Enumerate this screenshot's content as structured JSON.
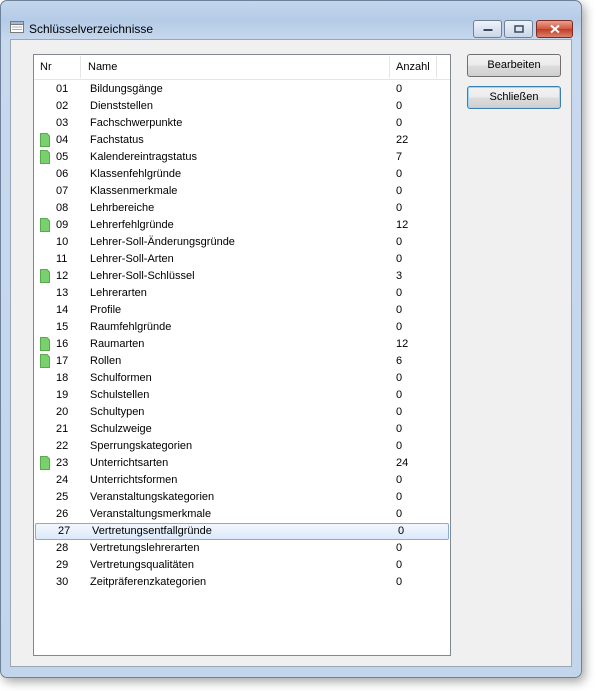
{
  "window": {
    "title": "Schlüsselverzeichnisse"
  },
  "columns": {
    "nr": "Nr",
    "name": "Name",
    "count": "Anzahl"
  },
  "buttons": {
    "edit": "Bearbeiten",
    "close": "Schließen"
  },
  "colors": {
    "doc_icon": "#79d16e",
    "selection": "#84acdd"
  },
  "rows": [
    {
      "nr": "01",
      "name": "Bildungsgänge",
      "count": "0",
      "icon": false
    },
    {
      "nr": "02",
      "name": "Dienststellen",
      "count": "0",
      "icon": false
    },
    {
      "nr": "03",
      "name": "Fachschwerpunkte",
      "count": "0",
      "icon": false
    },
    {
      "nr": "04",
      "name": "Fachstatus",
      "count": "22",
      "icon": true
    },
    {
      "nr": "05",
      "name": "Kalendereintragstatus",
      "count": "7",
      "icon": true
    },
    {
      "nr": "06",
      "name": "Klassenfehlgründe",
      "count": "0",
      "icon": false
    },
    {
      "nr": "07",
      "name": "Klassenmerkmale",
      "count": "0",
      "icon": false
    },
    {
      "nr": "08",
      "name": "Lehrbereiche",
      "count": "0",
      "icon": false
    },
    {
      "nr": "09",
      "name": "Lehrerfehlgründe",
      "count": "12",
      "icon": true
    },
    {
      "nr": "10",
      "name": "Lehrer-Soll-Änderungsgründe",
      "count": "0",
      "icon": false
    },
    {
      "nr": "11",
      "name": "Lehrer-Soll-Arten",
      "count": "0",
      "icon": false
    },
    {
      "nr": "12",
      "name": "Lehrer-Soll-Schlüssel",
      "count": "3",
      "icon": true
    },
    {
      "nr": "13",
      "name": "Lehrerarten",
      "count": "0",
      "icon": false
    },
    {
      "nr": "14",
      "name": "Profile",
      "count": "0",
      "icon": false
    },
    {
      "nr": "15",
      "name": "Raumfehlgründe",
      "count": "0",
      "icon": false
    },
    {
      "nr": "16",
      "name": "Raumarten",
      "count": "12",
      "icon": true
    },
    {
      "nr": "17",
      "name": "Rollen",
      "count": "6",
      "icon": true
    },
    {
      "nr": "18",
      "name": "Schulformen",
      "count": "0",
      "icon": false
    },
    {
      "nr": "19",
      "name": "Schulstellen",
      "count": "0",
      "icon": false
    },
    {
      "nr": "20",
      "name": "Schultypen",
      "count": "0",
      "icon": false
    },
    {
      "nr": "21",
      "name": "Schulzweige",
      "count": "0",
      "icon": false
    },
    {
      "nr": "22",
      "name": "Sperrungskategorien",
      "count": "0",
      "icon": false
    },
    {
      "nr": "23",
      "name": "Unterrichtsarten",
      "count": "24",
      "icon": true
    },
    {
      "nr": "24",
      "name": "Unterrichtsformen",
      "count": "0",
      "icon": false
    },
    {
      "nr": "25",
      "name": "Veranstaltungskategorien",
      "count": "0",
      "icon": false
    },
    {
      "nr": "26",
      "name": "Veranstaltungsmerkmale",
      "count": "0",
      "icon": false
    },
    {
      "nr": "27",
      "name": "Vertretungsentfallgründe",
      "count": "0",
      "icon": false,
      "selected": true
    },
    {
      "nr": "28",
      "name": "Vertretungslehrerarten",
      "count": "0",
      "icon": false
    },
    {
      "nr": "29",
      "name": "Vertretungsqualitäten",
      "count": "0",
      "icon": false
    },
    {
      "nr": "30",
      "name": "Zeitpräferenzkategorien",
      "count": "0",
      "icon": false
    }
  ]
}
